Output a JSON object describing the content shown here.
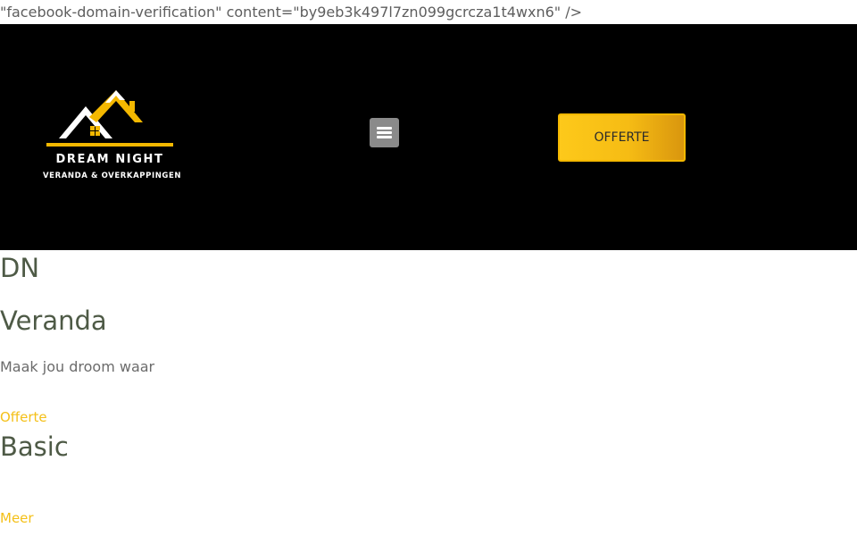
{
  "meta_text": "\"facebook-domain-verification\" content=\"by9eb3k497l7zn099gcrcza1t4wxn6\" />",
  "header": {
    "logo": {
      "icon": "house-roof-icon",
      "title": "DREAM NIGHT",
      "subtitle": "VERANDA & OVERKAPPINGEN"
    },
    "menu_icon": "hamburger-menu-icon",
    "cta_label": "OFFERTE"
  },
  "content": {
    "heading_1": "DN",
    "heading_2": "Veranda",
    "tagline": "Maak jou droom waar",
    "offerte_link": "Offerte",
    "heading_3": "Basic",
    "meer_link": "Meer"
  },
  "colors": {
    "header_bg": "#000000",
    "accent_yellow": "#f4c018",
    "heading_green": "#4e5a46",
    "menu_toggle_bg": "#8a8a8a"
  }
}
